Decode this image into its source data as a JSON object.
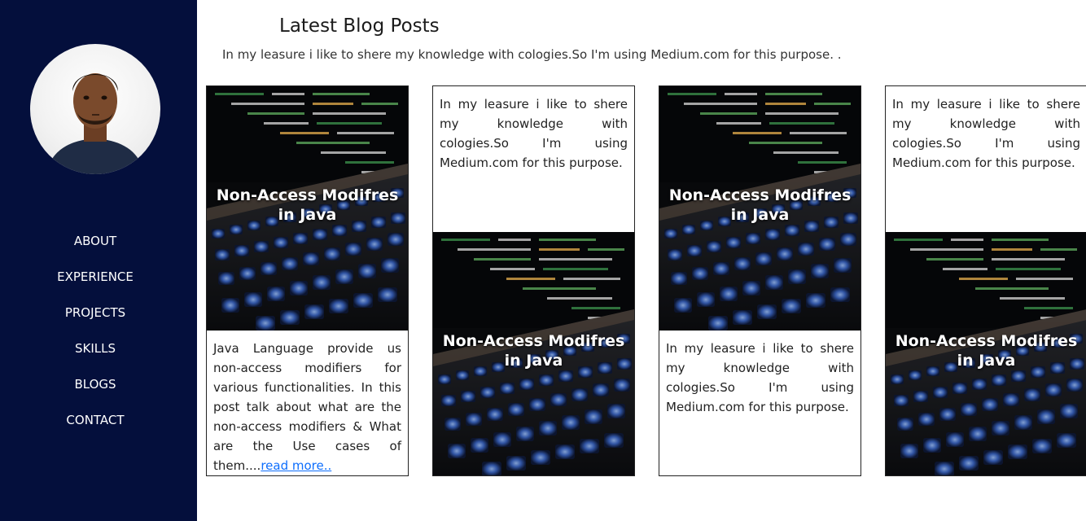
{
  "sidebar": {
    "nav": [
      "ABOUT",
      "EXPERIENCE",
      "PROJECTS",
      "SKILLS",
      "BLOGS",
      "CONTACT"
    ]
  },
  "main": {
    "title": "Latest Blog Posts",
    "intro": "In my leasure i like to shere my knowledge with cologies.So I'm using Medium.com for this purpose. .",
    "post_title": "Non-Access Modifres in Java",
    "post_excerpt": "Java Language provide us non-access modifiers for various functionalities. In this post talk about what are the non-access modifiers & What are the Use cases of them....",
    "read_more": "read more..",
    "card_text": "In my leasure i like to shere my knowledge with cologies.So I'm using Medium.com for this purpose."
  },
  "colors": {
    "sidebar_bg": "#040f3c",
    "link": "#0d6efd"
  }
}
